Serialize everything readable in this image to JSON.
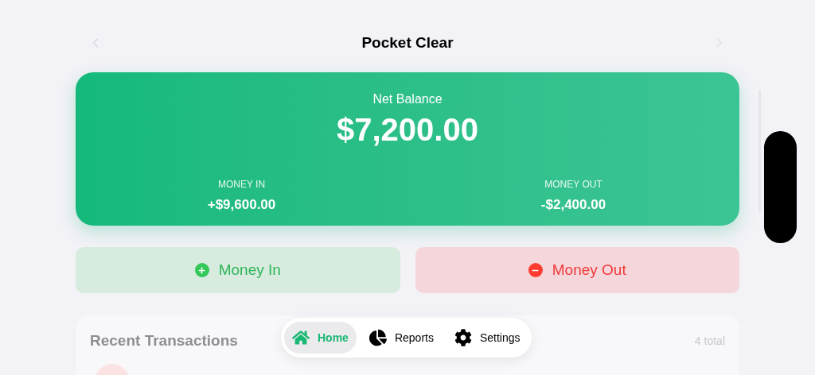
{
  "header": {
    "title": "Pocket Clear"
  },
  "balance_card": {
    "label": "Net Balance",
    "amount": "$7,200.00",
    "stats": [
      {
        "label": "MONEY IN",
        "value": "+$9,600.00"
      },
      {
        "label": "MONEY OUT",
        "value": "-$2,400.00"
      }
    ]
  },
  "actions": [
    {
      "kind": "in",
      "label": "Money In"
    },
    {
      "kind": "out",
      "label": "Money Out"
    }
  ],
  "recent": {
    "title": "Recent Transactions",
    "count": "4 total"
  },
  "tab_bar": [
    {
      "kind": "home",
      "label": "Home",
      "selected": true
    },
    {
      "kind": "reports",
      "label": "Reports",
      "selected": false
    },
    {
      "kind": "settings",
      "label": "Settings",
      "selected": false
    }
  ]
}
